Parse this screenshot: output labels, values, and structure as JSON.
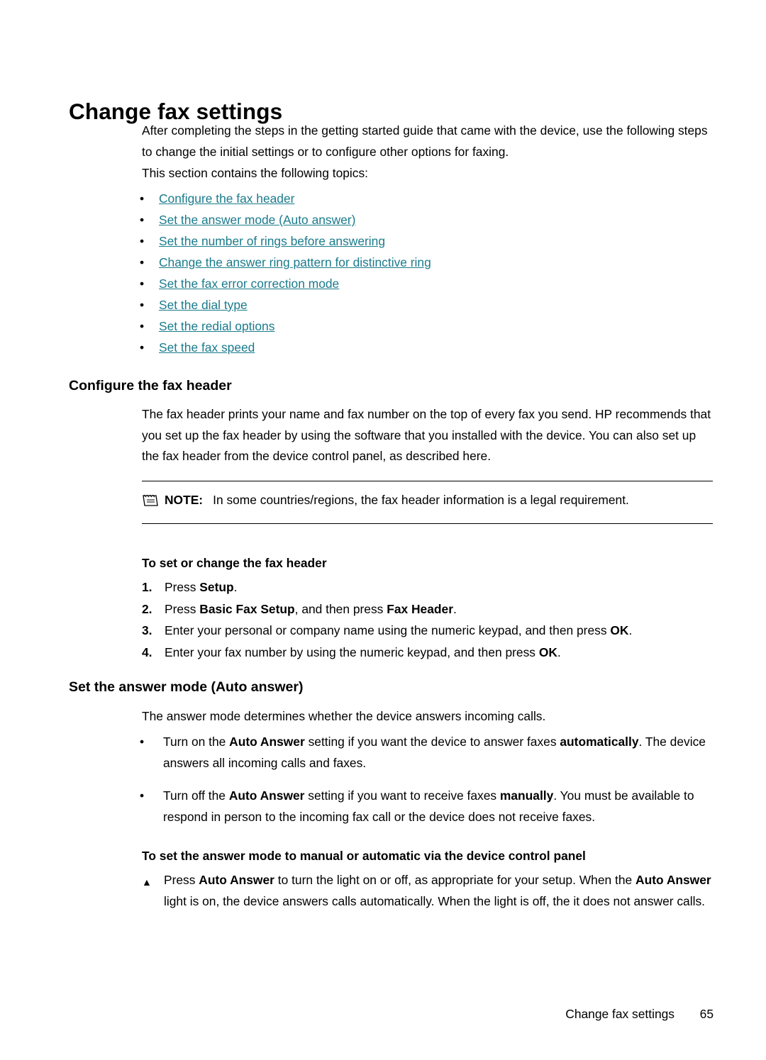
{
  "page": {
    "title": "Change fax settings",
    "intro_paragraph": "After completing the steps in the getting started guide that came with the device, use the following steps to change the initial settings or to configure other options for faxing.",
    "topics_lead": "This section contains the following topics:",
    "bullet_glyph": "•",
    "triangle_glyph": "▲",
    "link_color": "#1a7b8c"
  },
  "topics": [
    {
      "label": "Configure the fax header"
    },
    {
      "label": "Set the answer mode (Auto answer)"
    },
    {
      "label": "Set the number of rings before answering"
    },
    {
      "label": "Change the answer ring pattern for distinctive ring"
    },
    {
      "label": "Set the fax error correction mode"
    },
    {
      "label": "Set the dial type"
    },
    {
      "label": "Set the redial options"
    },
    {
      "label": "Set the fax speed"
    }
  ],
  "section_header": {
    "heading": "Configure the fax header",
    "paragraph": "The fax header prints your name and fax number on the top of every fax you send. HP recommends that you set up the fax header by using the software that you installed with the device. You can also set up the fax header from the device control panel, as described here.",
    "note": {
      "icon": "note-icon",
      "label": "NOTE:",
      "text": "In some countries/regions, the fax header information is a legal requirement."
    },
    "procedure_title": "To set or change the fax header",
    "steps": [
      {
        "num": "1.",
        "prefix": "Press ",
        "bold1": "Setup",
        "suffix": "."
      },
      {
        "num": "2.",
        "prefix": "Press ",
        "bold1": "Basic Fax Setup",
        "mid": ", and then press ",
        "bold2": "Fax Header",
        "suffix": "."
      },
      {
        "num": "3.",
        "prefix": "Enter your personal or company name using the numeric keypad, and then press ",
        "bold1": "OK",
        "suffix": "."
      },
      {
        "num": "4.",
        "prefix": "Enter your fax number by using the numeric keypad, and then press ",
        "bold1": "OK",
        "suffix": "."
      }
    ]
  },
  "section_answer": {
    "heading": "Set the answer mode (Auto answer)",
    "paragraph": "The answer mode determines whether the device answers incoming calls.",
    "bullets": [
      {
        "part1": "Turn on the ",
        "bold1": "Auto Answer",
        "part2": " setting if you want the device to answer faxes ",
        "bold2": "automatically",
        "part3": ". The device answers all incoming calls and faxes."
      },
      {
        "part1": "Turn off the ",
        "bold1": "Auto Answer",
        "part2": " setting if you want to receive faxes ",
        "bold2": "manually",
        "part3": ". You must be available to respond in person to the incoming fax call or the device does not receive faxes."
      }
    ],
    "procedure_title": "To set the answer mode to manual or automatic via the device control panel",
    "triangle_step": {
      "part1": "Press ",
      "bold1": "Auto Answer",
      "part2": " to turn the light on or off, as appropriate for your setup. When the ",
      "bold2": "Auto Answer",
      "part3": " light is on, the device answers calls automatically. When the light is off, the it does not answer calls."
    }
  },
  "footer": {
    "title": "Change fax settings",
    "page_number": "65"
  }
}
